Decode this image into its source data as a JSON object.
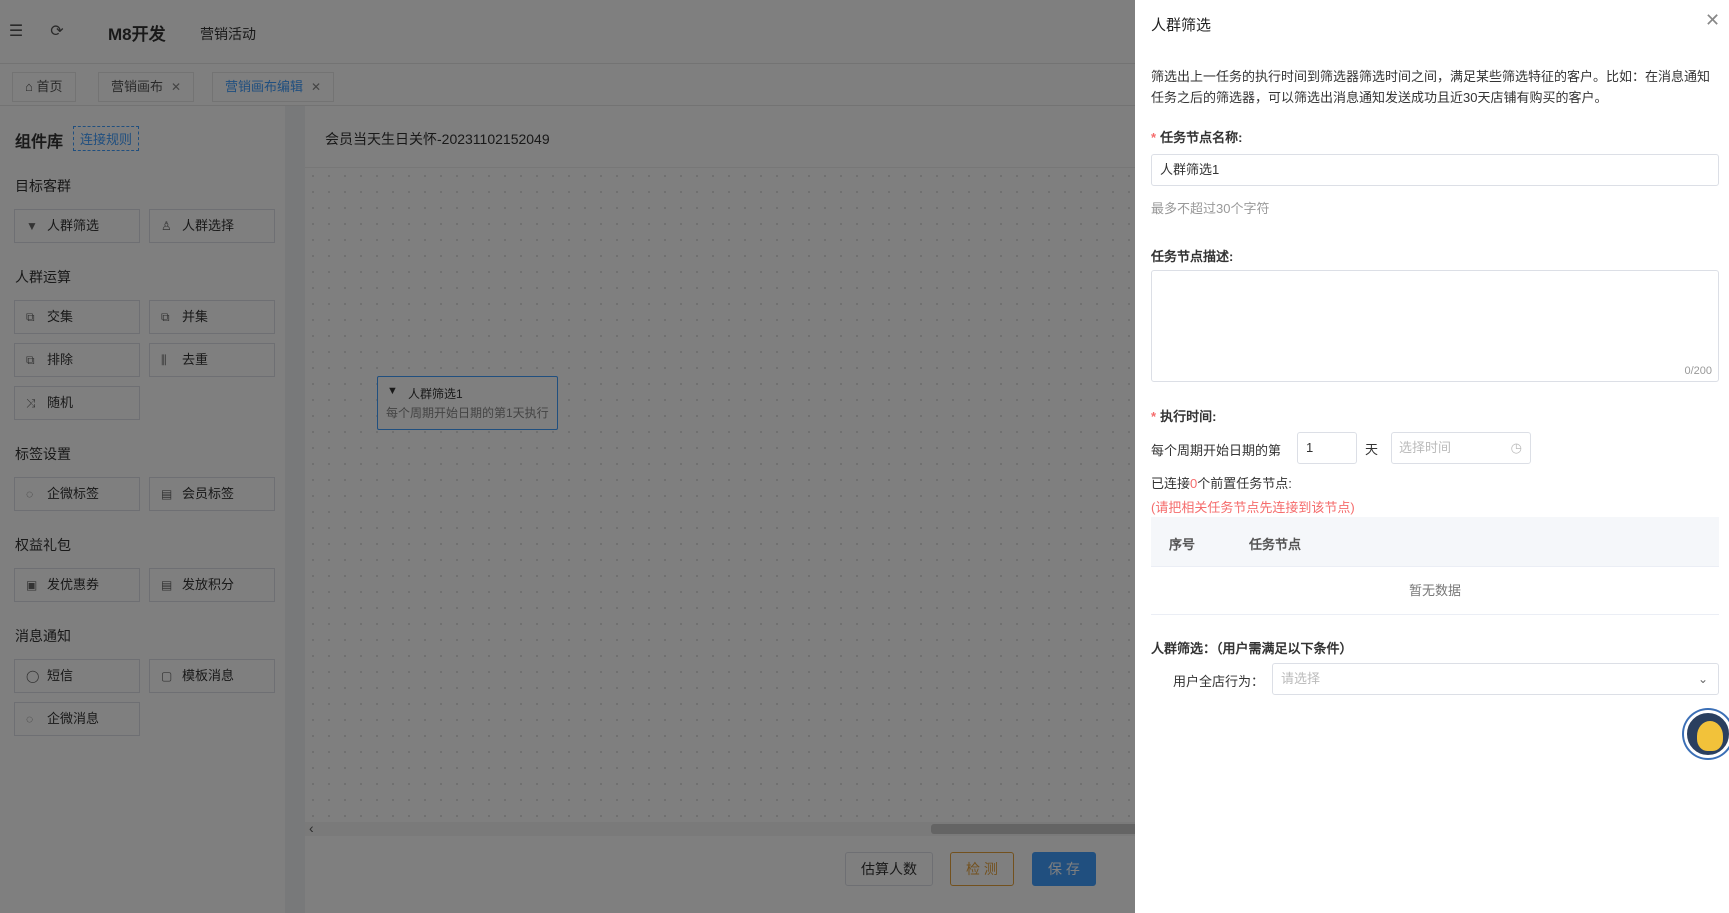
{
  "topbar": {
    "brand": "M8开发",
    "menu": "营销活动",
    "collapse_icon": "menu-fold-icon",
    "refresh_icon": "refresh-icon"
  },
  "tabs": [
    {
      "label": "首页",
      "icon": "home-icon",
      "closable": false
    },
    {
      "label": "营销画布",
      "closable": true
    },
    {
      "label": "营销画布编辑",
      "closable": true,
      "active": true
    }
  ],
  "library": {
    "title": "组件库",
    "rule_link": "连接规则",
    "groups": [
      {
        "title": "目标客群",
        "items": [
          {
            "label": "人群筛选",
            "icon": "funnel-icon"
          },
          {
            "label": "人群选择",
            "icon": "user-icon"
          }
        ]
      },
      {
        "title": "人群运算",
        "items": [
          {
            "label": "交集",
            "icon": "intersect-icon"
          },
          {
            "label": "并集",
            "icon": "union-icon"
          },
          {
            "label": "排除",
            "icon": "exclude-icon"
          },
          {
            "label": "去重",
            "icon": "dedup-icon"
          },
          {
            "label": "随机",
            "icon": "shuffle-icon"
          }
        ]
      },
      {
        "title": "标签设置",
        "items": [
          {
            "label": "企微标签",
            "icon": "tag-icon"
          },
          {
            "label": "会员标签",
            "icon": "member-tag-icon"
          }
        ]
      },
      {
        "title": "权益礼包",
        "items": [
          {
            "label": "发优惠券",
            "icon": "coupon-icon"
          },
          {
            "label": "发放积分",
            "icon": "points-icon"
          }
        ]
      },
      {
        "title": "消息通知",
        "items": [
          {
            "label": "短信",
            "icon": "sms-icon"
          },
          {
            "label": "模板消息",
            "icon": "template-msg-icon"
          },
          {
            "label": "企微消息",
            "icon": "wecom-msg-icon"
          }
        ]
      }
    ]
  },
  "canvas": {
    "title": "会员当天生日关怀-20231102152049",
    "node": {
      "title": "人群筛选1",
      "desc": "每个周期开始日期的第1天执行"
    },
    "buttons": {
      "estimate": "估算人数",
      "check": "检 测",
      "save": "保 存"
    }
  },
  "drawer": {
    "title": "人群筛选",
    "intro": "筛选出上一任务的执行时间到筛选器筛选时间之间，满足某些筛选特征的客户。比如：在消息通知任务之后的筛选器，可以筛选出消息通知发送成功且近30天店铺有购买的客户。",
    "name_label": "任务节点名称:",
    "name_value": "人群筛选1",
    "name_hint": "最多不超过30个字符",
    "desc_label": "任务节点描述:",
    "desc_count": "0/200",
    "exec_label": "执行时间:",
    "exec_prefix": "每个周期开始日期的第",
    "exec_day": "1",
    "exec_unit": "天",
    "time_placeholder": "选择时间",
    "conn_pre": "已连接",
    "conn_count": "0",
    "conn_post": "个前置任务节点:",
    "conn_warn": "(请把相关任务节点先连接到该节点)",
    "table_headers": [
      "序号",
      "任务节点"
    ],
    "table_empty": "暂无数据",
    "crowd_title": "人群筛选：（用户需满足以下条件）",
    "crowd_label": "用户全店行为：",
    "crowd_placeholder": "请选择"
  }
}
